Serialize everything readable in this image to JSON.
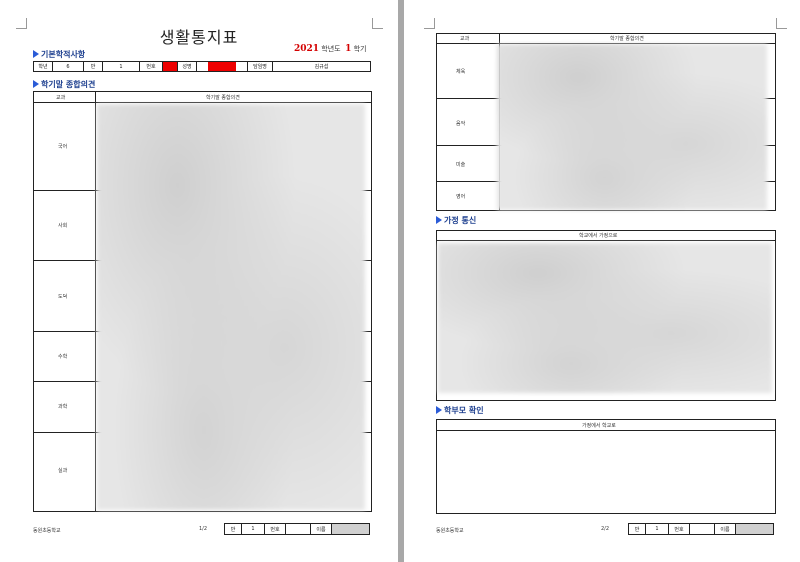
{
  "page1": {
    "title": "생활통지표",
    "year": "2021",
    "year_suffix": "학년도",
    "term": "1",
    "term_suffix": "학기",
    "basic_section": "기본학적사항",
    "basic_row": {
      "grade_label": "학년",
      "grade_value": "6",
      "class_label": "반",
      "class_value": "1",
      "number_label": "번호",
      "name_label": "성명",
      "teacher_label": "담임명",
      "teacher_value": "김규섭"
    },
    "opinion_section": "학기말 종합의견",
    "table_head": {
      "subject": "교과",
      "opinion": "학기말 종합의견"
    },
    "subjects": [
      "국어",
      "사회",
      "도덕",
      "수학",
      "과학",
      "실과"
    ],
    "footer": {
      "school": "동원초등학교",
      "page": "1/2",
      "class_label": "반",
      "class_value": "1",
      "number_label": "번호",
      "name_label": "이름"
    }
  },
  "page2": {
    "table_head": {
      "subject": "교과",
      "opinion": "학기말 종합의견"
    },
    "subjects": [
      "체육",
      "음악",
      "미술",
      "영어"
    ],
    "home_section": "가정 통신",
    "home_head": "학교에서 가정으로",
    "parent_section": "학부모 확인",
    "parent_head": "가정에서 학교로",
    "footer": {
      "school": "동원초등학교",
      "page": "2/2",
      "class_label": "반",
      "class_value": "1",
      "number_label": "번호",
      "name_label": "이름"
    }
  },
  "colors": {
    "accent_red": "#d40000",
    "section_blue": "#1d3f8f",
    "redact": "#ee0000"
  }
}
